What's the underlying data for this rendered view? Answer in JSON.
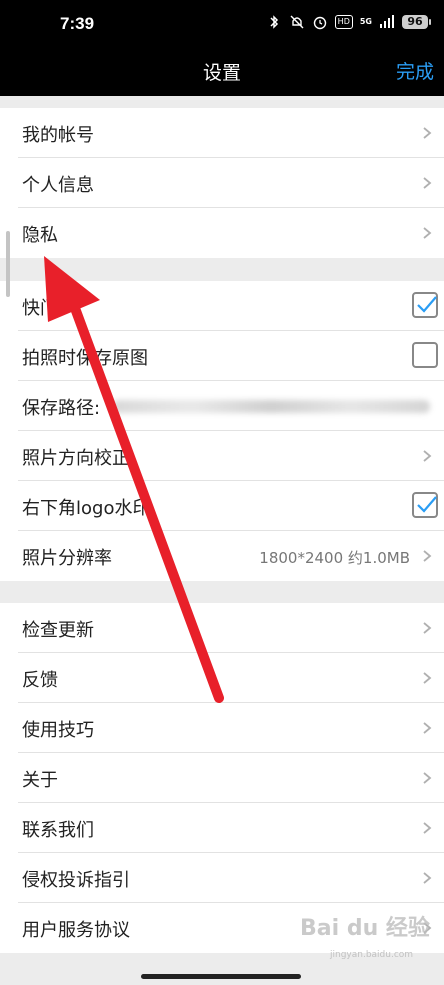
{
  "status": {
    "time": "7:39",
    "network": "5G",
    "battery": "96"
  },
  "nav": {
    "title": "设置",
    "done": "完成"
  },
  "account_group": [
    {
      "label": "我的帐号"
    },
    {
      "label": "个人信息"
    },
    {
      "label": "隐私"
    }
  ],
  "camera_group": {
    "shutter_sound": {
      "label": "快门声",
      "checked": true
    },
    "save_original": {
      "label": "拍照时保存原图",
      "checked": false
    },
    "save_path": {
      "label": "保存路径:"
    },
    "orientation": {
      "label": "照片方向校正"
    },
    "logo_watermark": {
      "label": "右下角logo水印",
      "checked": true
    },
    "resolution": {
      "label": "照片分辨率",
      "value": "1800*2400 约1.0MB"
    }
  },
  "misc_group": [
    {
      "label": "检查更新"
    },
    {
      "label": "反馈"
    },
    {
      "label": "使用技巧"
    },
    {
      "label": "关于"
    },
    {
      "label": "联系我们"
    },
    {
      "label": "侵权投诉指引"
    },
    {
      "label": "用户服务协议"
    }
  ],
  "watermark": {
    "text": "Bai du 经验",
    "sub": "jingyan.baidu.com"
  },
  "colors": {
    "accent": "#2a9df4",
    "arrow": "#e8202a",
    "checkbox_check": "#2a9df4"
  }
}
